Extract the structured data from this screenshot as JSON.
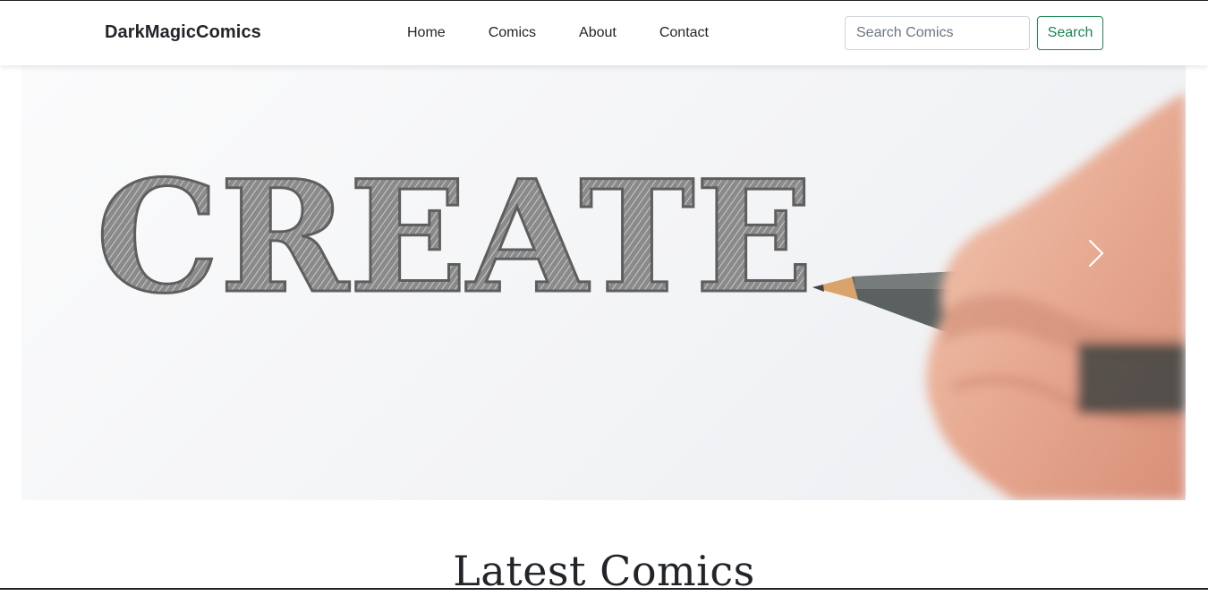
{
  "navbar": {
    "brand": "DarkMagicComics",
    "links": [
      {
        "label": "Home"
      },
      {
        "label": "Comics"
      },
      {
        "label": "About"
      },
      {
        "label": "Contact"
      }
    ],
    "search": {
      "placeholder": "Search Comics",
      "value": "",
      "button_label": "Search",
      "accent_color": "#198754"
    }
  },
  "carousel": {
    "slide_word": "CREATE",
    "next_icon": "chevron-right-icon"
  },
  "main": {
    "section_title": "Latest Comics"
  }
}
